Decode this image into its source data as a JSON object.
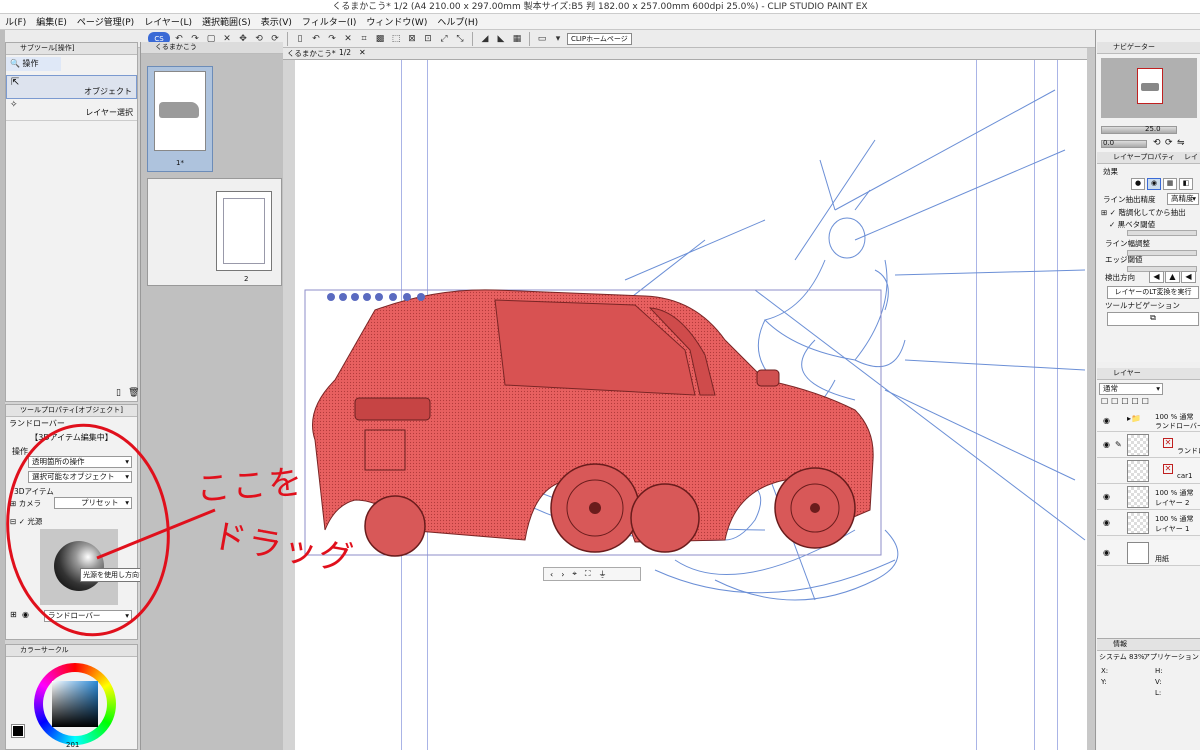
{
  "window": {
    "title": "くるまかこう* 1/2 (A4 210.00 x 297.00mm 製本サイズ:B5 判 182.00 x 257.00mm 600dpi 25.0%) - CLIP STUDIO PAINT EX"
  },
  "menu": [
    "ル(F)",
    "編集(E)",
    "ページ管理(P)",
    "レイヤー(L)",
    "選択範囲(S)",
    "表示(V)",
    "フィルター(I)",
    "ウィンドウ(W)",
    "ヘルプ(H)"
  ],
  "toolbar": {
    "home_label": "CLIPホームページ"
  },
  "subtool": {
    "tab": "サブツール[操作]",
    "group": "操作",
    "items": [
      "オブジェクト",
      "レイヤー選択"
    ]
  },
  "pages": {
    "tab": "くるまかこう",
    "page1_label": "1*",
    "page2_label": "2"
  },
  "canvas": {
    "tab_label": "くるまかこう*",
    "page_indicator": "1/2"
  },
  "tool_property": {
    "tab": "ツールプロパティ[オブジェクト]",
    "object_name": "ランドローバー",
    "editing_label": "【3Dアイテム編集中】",
    "operation_label": "操作",
    "operation_value": "透明箇所の操作",
    "selectable_value": "選択可能なオブジェクト",
    "item_section": "3Dアイテム",
    "camera_label": "カメラ",
    "preset_label": "プリセット",
    "light_label": "光源",
    "tooltip": "光源を使用し方向を設定します",
    "bottom_select": "ランドローバー"
  },
  "annotation": {
    "line1": "ここを",
    "line2": "ドラッグ"
  },
  "color_wheel": {
    "tab": "カラーサークル",
    "value_readout": "201"
  },
  "navigator": {
    "tab": "ナビゲーター",
    "zoom": "25.0",
    "rotation": "0.0"
  },
  "layer_property": {
    "tab": "レイヤープロパティ",
    "tab2": "レイ",
    "effect_label": "効果",
    "line_precision_label": "ライン抽出精度",
    "line_precision_value": "高精度",
    "posterize_label": "階調化してから抽出",
    "black_threshold_label": "黒ベタ閾値",
    "line_width_label": "ライン幅調整",
    "edge_threshold_label": "エッジ閾値",
    "detect_direction_label": "検出方向",
    "lt_button": "レイヤーのLT変換を実行",
    "tool_nav_label": "ツールナビゲーション"
  },
  "layers": {
    "tab": "レイヤー",
    "blend_mode": "通常",
    "rows": [
      {
        "line1": "100 % 通常",
        "line2": "ランドローバー 2"
      },
      {
        "line1": "",
        "line2": "ランドロ"
      },
      {
        "line1": "",
        "line2": "car1"
      },
      {
        "line1": "100 % 通常",
        "line2": "レイヤー 2"
      },
      {
        "line1": "100 % 通常",
        "line2": "レイヤー 1"
      },
      {
        "line1": "",
        "line2": "用紙"
      }
    ]
  },
  "info": {
    "tab": "情報",
    "system": "システム 83%",
    "app": "アプリケーション 74%",
    "labels": [
      "X:",
      "Y:",
      "H:",
      "V:",
      "L:"
    ]
  },
  "colors": {
    "selection": "#e86060",
    "sketch": "#6b8fd6",
    "annotation": "#e0101c"
  }
}
